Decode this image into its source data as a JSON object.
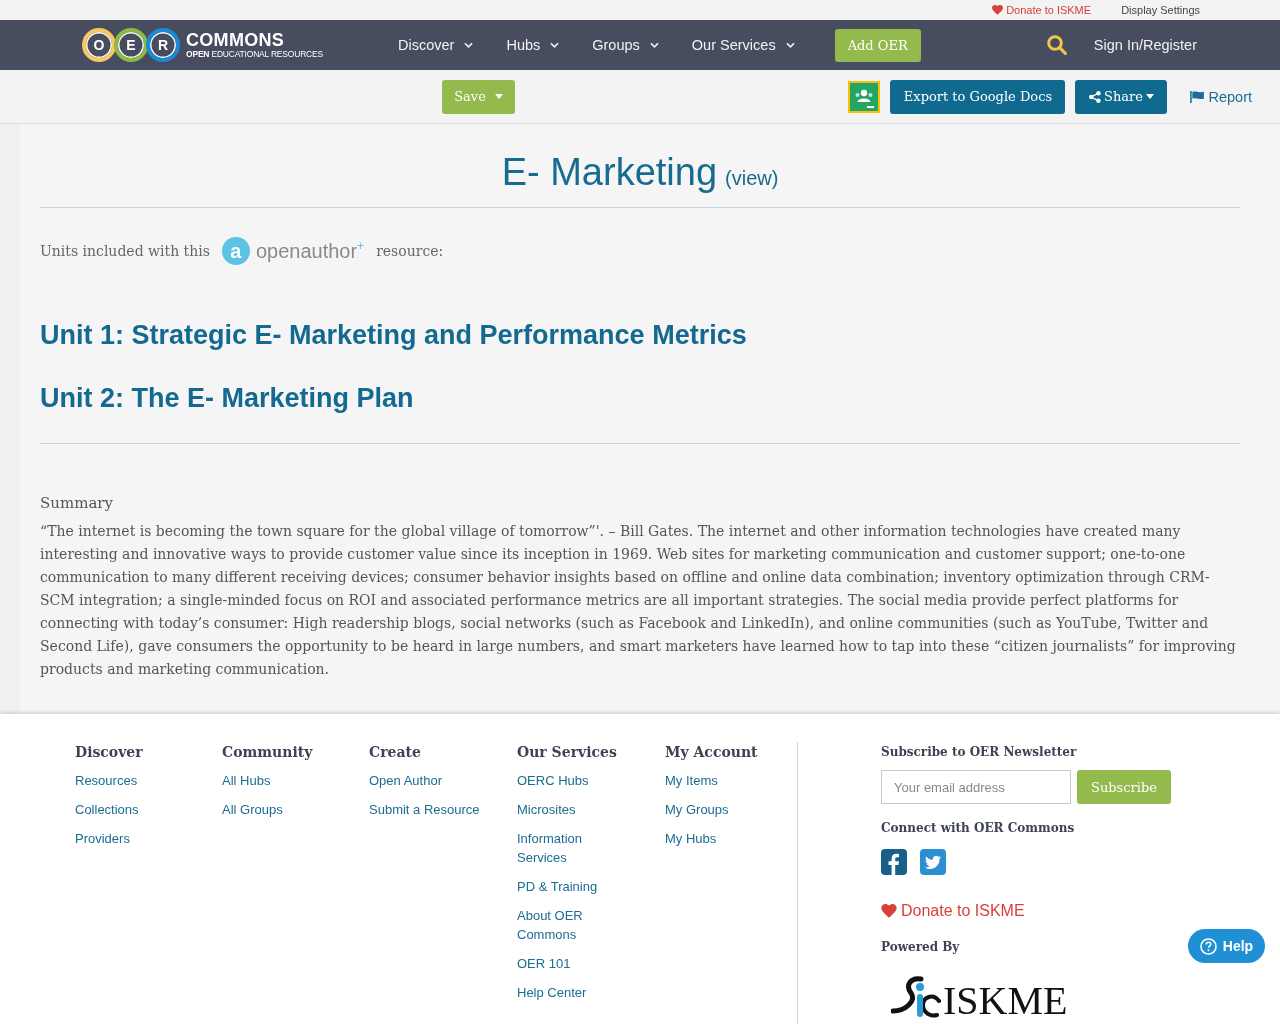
{
  "top_bar": {
    "links": [
      {
        "kind": "donate",
        "label": "Donate to ISKME"
      },
      {
        "kind": "plain",
        "label": "Display Settings"
      }
    ]
  },
  "nav": {
    "logo": {
      "letters": [
        {
          "letter": "O",
          "color": "#f6c85f"
        },
        {
          "letter": "E",
          "color": "#8dba45"
        },
        {
          "letter": "R",
          "color": "#1b8ad0"
        }
      ],
      "wordmark": "COMMONS",
      "tagline": "**OPEN** EDUCATIONAL RESOURCES"
    },
    "menu": [
      {
        "label": "Discover"
      },
      {
        "label": "Hubs"
      },
      {
        "label": "Groups"
      },
      {
        "label": "Our Services"
      }
    ],
    "add_button": "Add OER",
    "sign_in": "Sign In/Register"
  },
  "toolbar": {
    "save": "Save",
    "export": "Export to Google Docs",
    "share": "Share",
    "report": "Report"
  },
  "resource": {
    "title": "E- Marketing",
    "view_link": "(view)",
    "units_intro": "Units included with this",
    "openauthor": {
      "mark": "a",
      "text": "openauthor$^{+}$"
    },
    "units_outro": "resource:",
    "units": [
      "Unit 1: Strategic E- Marketing and Performance Metrics",
      "Unit 2: The E- Marketing Plan"
    ],
    "summary_label": "Summary",
    "summary": "“The internet is becoming the town square for the global village of tomorrow”'. – Bill Gates. The internet and other information technologies have created many interesting and innovative ways to provide customer value since its inception in 1969. Web sites for marketing communication and customer support; one-to-one communication to many different receiving devices; consumer behavior insights based on offline and online data combination; inventory optimization through CRM-SCM integration; a single-minded focus on ROI and associated performance metrics are all important strategies. The social media provide perfect platforms for connecting with today’s consumer: High readership blogs, social networks (such as Facebook and LinkedIn), and online communities (such as YouTube, Twitter and Second Life), gave consumers the opportunity to be heard in large numbers, and smart marketers have learned how to tap into these “citizen journalists” for improving products and marketing communication."
  },
  "footer": {
    "columns": [
      {
        "heading": "Discover",
        "links": [
          "Resources",
          "Collections",
          "Providers"
        ]
      },
      {
        "heading": "Community",
        "links": [
          "All Hubs",
          "All Groups"
        ]
      },
      {
        "heading": "Create",
        "links": [
          "Open Author",
          "Submit a Resource"
        ]
      },
      {
        "heading": "Our Services",
        "links": [
          "OERC Hubs",
          "Microsites",
          "Information Services",
          "PD & Training",
          "About OER Commons",
          "OER 101",
          "Help Center"
        ]
      },
      {
        "heading": "My Account",
        "links": [
          "My Items",
          "My Groups",
          "My Hubs"
        ]
      }
    ],
    "newsletter": {
      "heading": "Subscribe to OER Newsletter",
      "placeholder": "Your email address",
      "button": "Subscribe"
    },
    "connect_heading": "Connect with OER Commons",
    "donate": "Donate to ISKME",
    "powered_by": "Powered By",
    "partner_logo": "ISKME"
  },
  "help_button": "Help"
}
